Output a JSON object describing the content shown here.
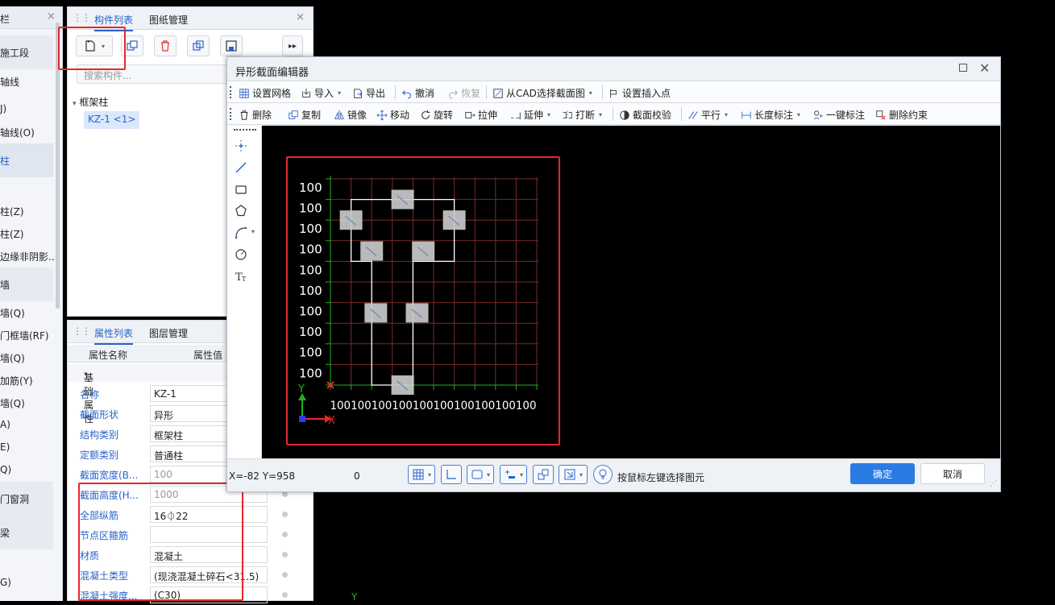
{
  "left_nav": {
    "title": "栏",
    "close": "×",
    "items": [
      "施工段",
      "轴线",
      "J)",
      "轴线(O)",
      "柱",
      "柱(Z)",
      "柱(Z)",
      "边缘非阴影...",
      "墙",
      "墙(Q)",
      "门框墙(RF)",
      "墙(Q)",
      "加筋(Y)",
      "墙(Q)",
      "A)",
      "E)",
      "Q)",
      "门窗洞",
      "梁",
      "G)"
    ]
  },
  "component_panel": {
    "tabs": [
      "构件列表",
      "图纸管理"
    ],
    "close": "×",
    "search_placeholder": "搜索构件...",
    "tree_root": "框架柱",
    "tree_child": "KZ-1 <1>",
    "toolbar_icons": [
      "new-component-icon",
      "copy-component-icon",
      "delete-icon",
      "duplicate-icon",
      "save-layer-icon",
      "more-icon"
    ]
  },
  "property_panel": {
    "tabs": [
      "属性列表",
      "图层管理"
    ],
    "col_name": "属性名称",
    "col_value": "属性值",
    "group": "基础属性",
    "rows": [
      {
        "name": "名称",
        "value": "KZ-1"
      },
      {
        "name": "截面形状",
        "value": "异形"
      },
      {
        "name": "结构类别",
        "value": "框架柱"
      },
      {
        "name": "定额类别",
        "value": "普通柱"
      },
      {
        "name": "截面宽度(B...",
        "value": "100"
      },
      {
        "name": "截面高度(H...",
        "value": "1000"
      },
      {
        "name": "全部纵筋",
        "value": "16⏀22"
      },
      {
        "name": "节点区箍筋",
        "value": ""
      },
      {
        "name": "材质",
        "value": "混凝土"
      },
      {
        "name": "混凝土类型",
        "value": "(现浇混凝土碎石<31.5)"
      },
      {
        "name": "混凝土强度...",
        "value": "(C30)"
      }
    ]
  },
  "dialog": {
    "title": "异形截面编辑器",
    "toolbar1": [
      {
        "label": "设置网格",
        "icon": "grid-icon"
      },
      {
        "label": "导入",
        "icon": "import-icon",
        "dropdown": true
      },
      {
        "label": "导出",
        "icon": "export-icon"
      },
      {
        "label": "撤消",
        "icon": "undo-icon"
      },
      {
        "label": "恢复",
        "icon": "redo-icon",
        "disabled": true
      },
      {
        "label": "从CAD选择截面图",
        "icon": "cad-select-icon",
        "dropdown": true
      },
      {
        "label": "设置插入点",
        "icon": "insert-point-icon"
      }
    ],
    "toolbar2": [
      {
        "label": "删除",
        "icon": "delete-icon"
      },
      {
        "label": "复制",
        "icon": "copy-icon"
      },
      {
        "label": "镜像",
        "icon": "mirror-icon"
      },
      {
        "label": "移动",
        "icon": "move-icon"
      },
      {
        "label": "旋转",
        "icon": "rotate-icon"
      },
      {
        "label": "拉伸",
        "icon": "stretch-icon"
      },
      {
        "label": "延伸",
        "icon": "extend-icon",
        "dropdown": true
      },
      {
        "label": "打断",
        "icon": "break-icon",
        "dropdown": true
      },
      {
        "label": "截面校验",
        "icon": "check-icon"
      },
      {
        "label": "平行",
        "icon": "parallel-icon",
        "dropdown": true
      },
      {
        "label": "长度标注",
        "icon": "dimension-icon",
        "dropdown": true
      },
      {
        "label": "一键标注",
        "icon": "auto-dimension-icon"
      },
      {
        "label": "删除约束",
        "icon": "remove-constraint-icon"
      }
    ],
    "side_tools": [
      "point-icon",
      "line-icon",
      "rectangle-icon",
      "polygon-icon",
      "arc-icon",
      "circle-icon",
      "text-icon"
    ],
    "grid": {
      "y_labels": [
        "100",
        "100",
        "100",
        "100",
        "100",
        "100",
        "100",
        "100",
        "100",
        "100"
      ],
      "x_labels": [
        "100",
        "100",
        "100",
        "100",
        "100",
        "100",
        "100",
        "100",
        "100",
        "100"
      ],
      "axis_x": "X",
      "axis_y": "Y"
    },
    "status": {
      "coords": "X=-82 Y=958",
      "value": "0",
      "hint": "按鼠标左键选择图元",
      "ok": "确定",
      "cancel": "取消"
    }
  },
  "colors": {
    "accent": "#2a62c9",
    "primary_button": "#2b7be4",
    "annotation_red": "#e8262a",
    "grid_line": "#7a2a2a",
    "grid_green": "#1db31d"
  },
  "bottom_axis_label": "Y"
}
